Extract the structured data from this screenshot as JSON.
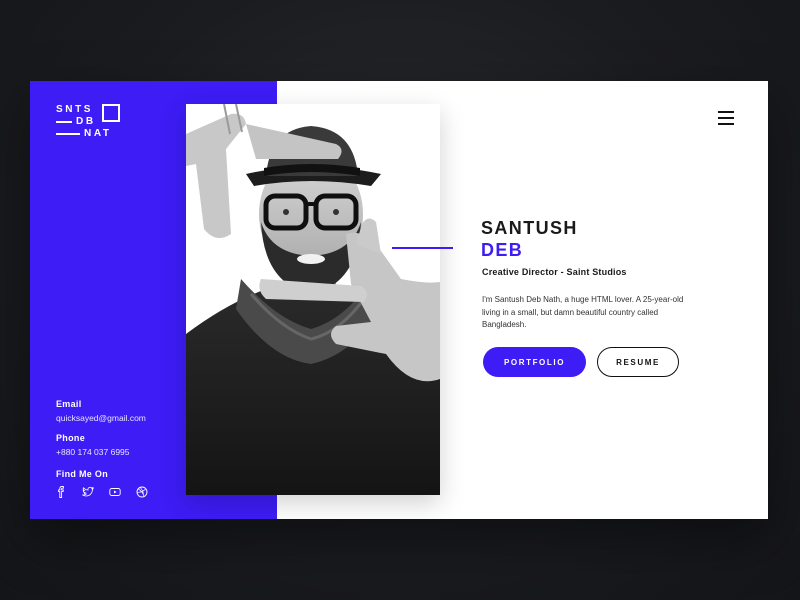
{
  "logo": {
    "line1": "SNTS",
    "line2": "DB",
    "line3": "NAT"
  },
  "profile": {
    "first_name": "SANTUSH",
    "last_name": "DEB",
    "role": "Creative Director - Saint Studios",
    "bio": "I'm Santush Deb Nath, a huge HTML lover. A 25-year-old living in a small, but damn beautiful country called Bangladesh."
  },
  "buttons": {
    "portfolio": "PORTFOLIO",
    "resume": "RESUME"
  },
  "contact": {
    "email_label": "Email",
    "email_value": "quicksayed@gmail.com",
    "phone_label": "Phone",
    "phone_value": "+880 174 037 6995",
    "find_label": "Find Me On"
  },
  "socials": [
    "facebook-icon",
    "twitter-icon",
    "youtube-icon",
    "dribbble-icon"
  ],
  "colors": {
    "accent": "#3d1cf5",
    "dark": "#1a1a1a",
    "background": "#1b1c20"
  }
}
